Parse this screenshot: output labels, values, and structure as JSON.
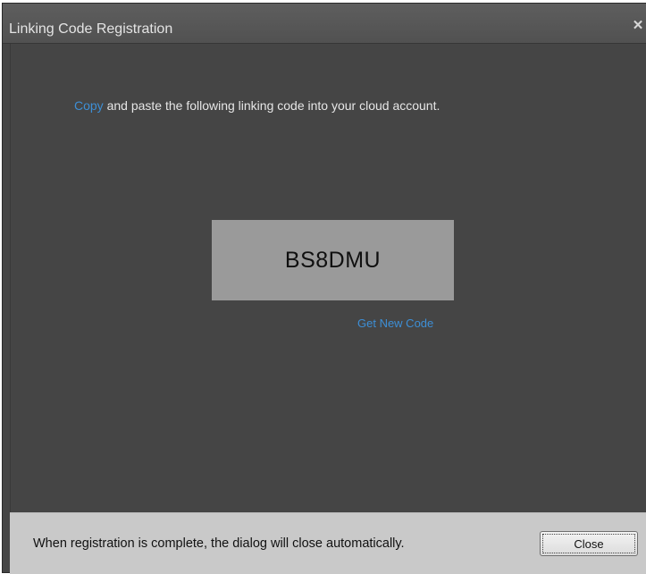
{
  "window": {
    "title": "Linking Code Registration",
    "close_icon": "close-icon"
  },
  "main": {
    "instruction_link": "Copy",
    "instruction_rest": " and paste the following linking code into your cloud account.",
    "linking_code": "BS8DMU",
    "new_code_link": "Get New Code"
  },
  "footer": {
    "message": "When registration is complete, the dialog will close automatically.",
    "close_button_label": "Close"
  },
  "colors": {
    "accent_link": "#3d8fd6",
    "panel_background": "#454545",
    "footer_background": "#c9c9c9",
    "code_box_background": "#9a9a9a"
  }
}
